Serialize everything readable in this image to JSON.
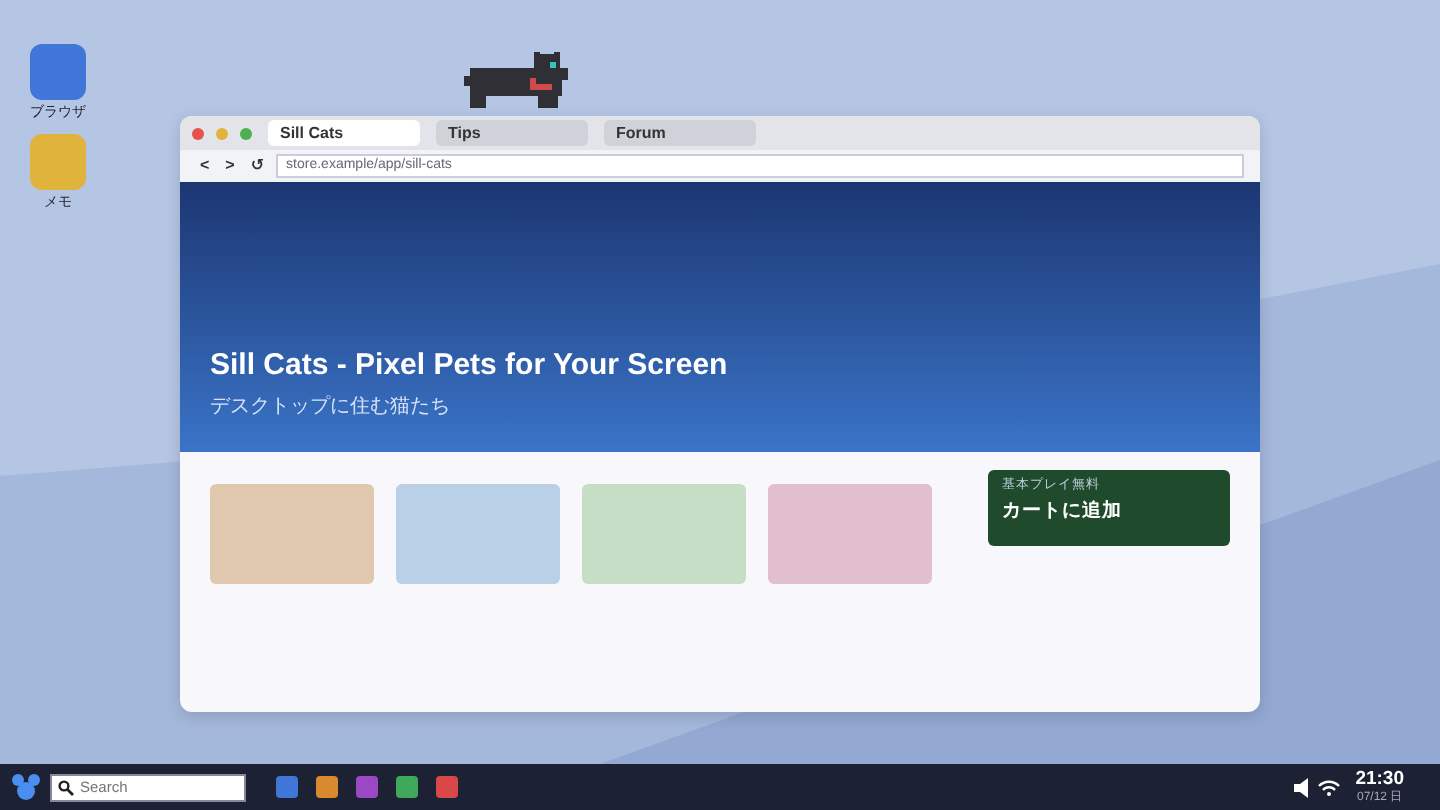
{
  "desktop_icons": [
    {
      "label": "ブラウザ",
      "color": "#3f76d8"
    },
    {
      "label": "メモ",
      "color": "#e0b43c"
    }
  ],
  "browser": {
    "tabs": [
      {
        "label": "Sill Cats",
        "selected": true
      },
      {
        "label": "Tips",
        "selected": false
      },
      {
        "label": "Forum",
        "selected": false
      }
    ],
    "nav": [
      "<",
      ">",
      "↺"
    ],
    "address": "store.example/app/sill-cats",
    "hero": {
      "title": "Sill Cats - Pixel Pets for Your Screen",
      "subtitle": "デスクトップに住む猫たち"
    },
    "cards": [
      {
        "color": "#dfc8ae"
      },
      {
        "color": "#b9d0e6"
      },
      {
        "color": "#c6dec6"
      },
      {
        "color": "#e2bfcd"
      }
    ],
    "promo": {
      "note": "基本プレイ無料",
      "action": "カートに追加"
    }
  },
  "taskbar": {
    "search": {
      "placeholder": "Search"
    },
    "apps": [
      {
        "color": "#3f76d8"
      },
      {
        "color": "#d98a2e"
      },
      {
        "color": "#9a48c4"
      },
      {
        "color": "#3fa85a"
      },
      {
        "color": "#d94848"
      }
    ],
    "time": "21:30",
    "date": "07/12 日"
  }
}
